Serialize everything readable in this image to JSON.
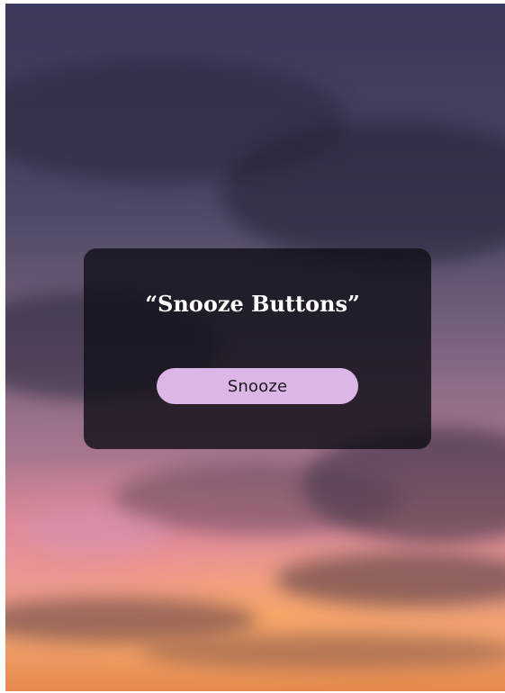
{
  "dialog": {
    "title": "“Snooze Buttons”",
    "snooze_label": "Snooze"
  },
  "colors": {
    "card_background": "#121018",
    "button_background": "#dcb6e6",
    "button_text": "#1e1a22",
    "title_text": "#ffffff"
  }
}
